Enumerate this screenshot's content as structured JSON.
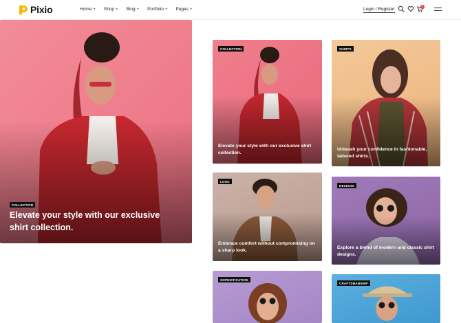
{
  "brand": {
    "name": "Pixio",
    "accent": "#f5b800"
  },
  "nav": [
    {
      "label": "Home",
      "suffix": "+"
    },
    {
      "label": "Shop",
      "suffix": "+"
    },
    {
      "label": "Blog",
      "suffix": "+"
    },
    {
      "label": "Portfolio",
      "suffix": "+"
    },
    {
      "label": "Pages",
      "suffix": "+"
    }
  ],
  "header": {
    "login_label": "Login / Register",
    "cart_count": "0",
    "icons": [
      "search-icon",
      "heart-icon",
      "cart-icon",
      "menu-icon"
    ]
  },
  "hero": {
    "tag": "COLLECTION",
    "title": "Elevate your style with our exclusive shirt collection."
  },
  "cards": [
    {
      "tag": "COLLECTION",
      "title": "Elevate your style with our exclusive shirt collection."
    },
    {
      "tag": "SHIRTS",
      "title": "Unleash your confidence in fashionable, tailored shirts."
    },
    {
      "tag": "LOOK",
      "title": "Embrace comfort without compromising on a sharp look."
    },
    {
      "tag": "DESIGNS",
      "title": "Explore a blend of modern and classic shirt designs."
    },
    {
      "tag": "SOPHISTICATION",
      "title": ""
    },
    {
      "tag": "CRAFTSMANSHIP",
      "title": ""
    }
  ]
}
